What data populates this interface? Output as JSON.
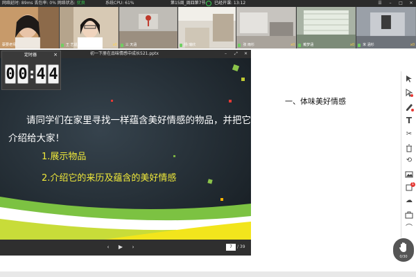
{
  "status_bar": {
    "network": "网络延时: 89ms 丢包率: 0% 网络状态:",
    "network_quality": "优良",
    "cpu": "系统CPU: 61%",
    "course": "第15周_周四第7节",
    "elapsed": "已经开课: 13:12"
  },
  "participants": [
    {
      "name": "蔡要老师",
      "badge": "",
      "scene": "teacher"
    },
    {
      "name": "王 艺说",
      "badge": "x0",
      "scene": "student"
    },
    {
      "name": "三 天涵",
      "badge": "",
      "scene": "room"
    },
    {
      "name": "杨 瑞欣",
      "badge": "",
      "scene": "room2"
    },
    {
      "name": "张 雨杉",
      "badge": "x0",
      "scene": "room3"
    },
    {
      "name": "戴梦涵",
      "badge": "x0",
      "scene": "room4"
    },
    {
      "name": "米 涵杉",
      "badge": "x0",
      "scene": "room5"
    }
  ],
  "timer": {
    "title": "定时器",
    "close": "×",
    "digits": [
      "0",
      "0",
      "4",
      "4"
    ],
    "separator": ":"
  },
  "ppt": {
    "file_title": "初一下册在品味情感中成长521.pptx",
    "slide_line1": "请同学们在家里寻找一样蕴含美好情感的物品，并把它",
    "slide_line2": "介绍给大家！",
    "item1": "1.展示物品",
    "item2": "2.介绍它的来历及蕴含的美好情感",
    "current_page": "7",
    "total_pages": "/ 39"
  },
  "whiteboard": {
    "heading": "一、体味美好情感"
  },
  "hand_raise": {
    "count": "0/30"
  }
}
